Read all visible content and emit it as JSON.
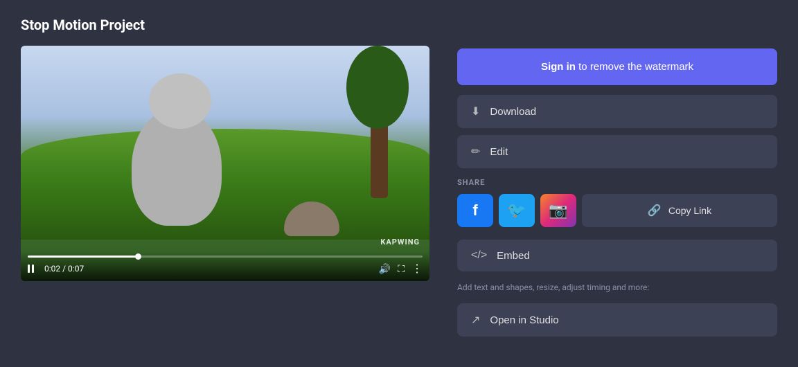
{
  "page": {
    "title": "Stop Motion Project",
    "background_color": "#2f3241"
  },
  "video": {
    "current_time": "0:02",
    "duration": "0:07",
    "progress_pct": 28,
    "watermark": "KAPWING"
  },
  "actions": {
    "sign_in_prefix": "Sign in",
    "sign_in_suffix": " to remove the watermark",
    "download_label": "Download",
    "edit_label": "Edit",
    "share_label": "SHARE",
    "copy_link_label": "Copy Link",
    "embed_label": "Embed",
    "studio_desc": "Add text and shapes, resize, adjust timing and more:",
    "open_studio_label": "Open in Studio"
  },
  "social": {
    "facebook_label": "f",
    "twitter_label": "t",
    "instagram_label": "ig"
  }
}
